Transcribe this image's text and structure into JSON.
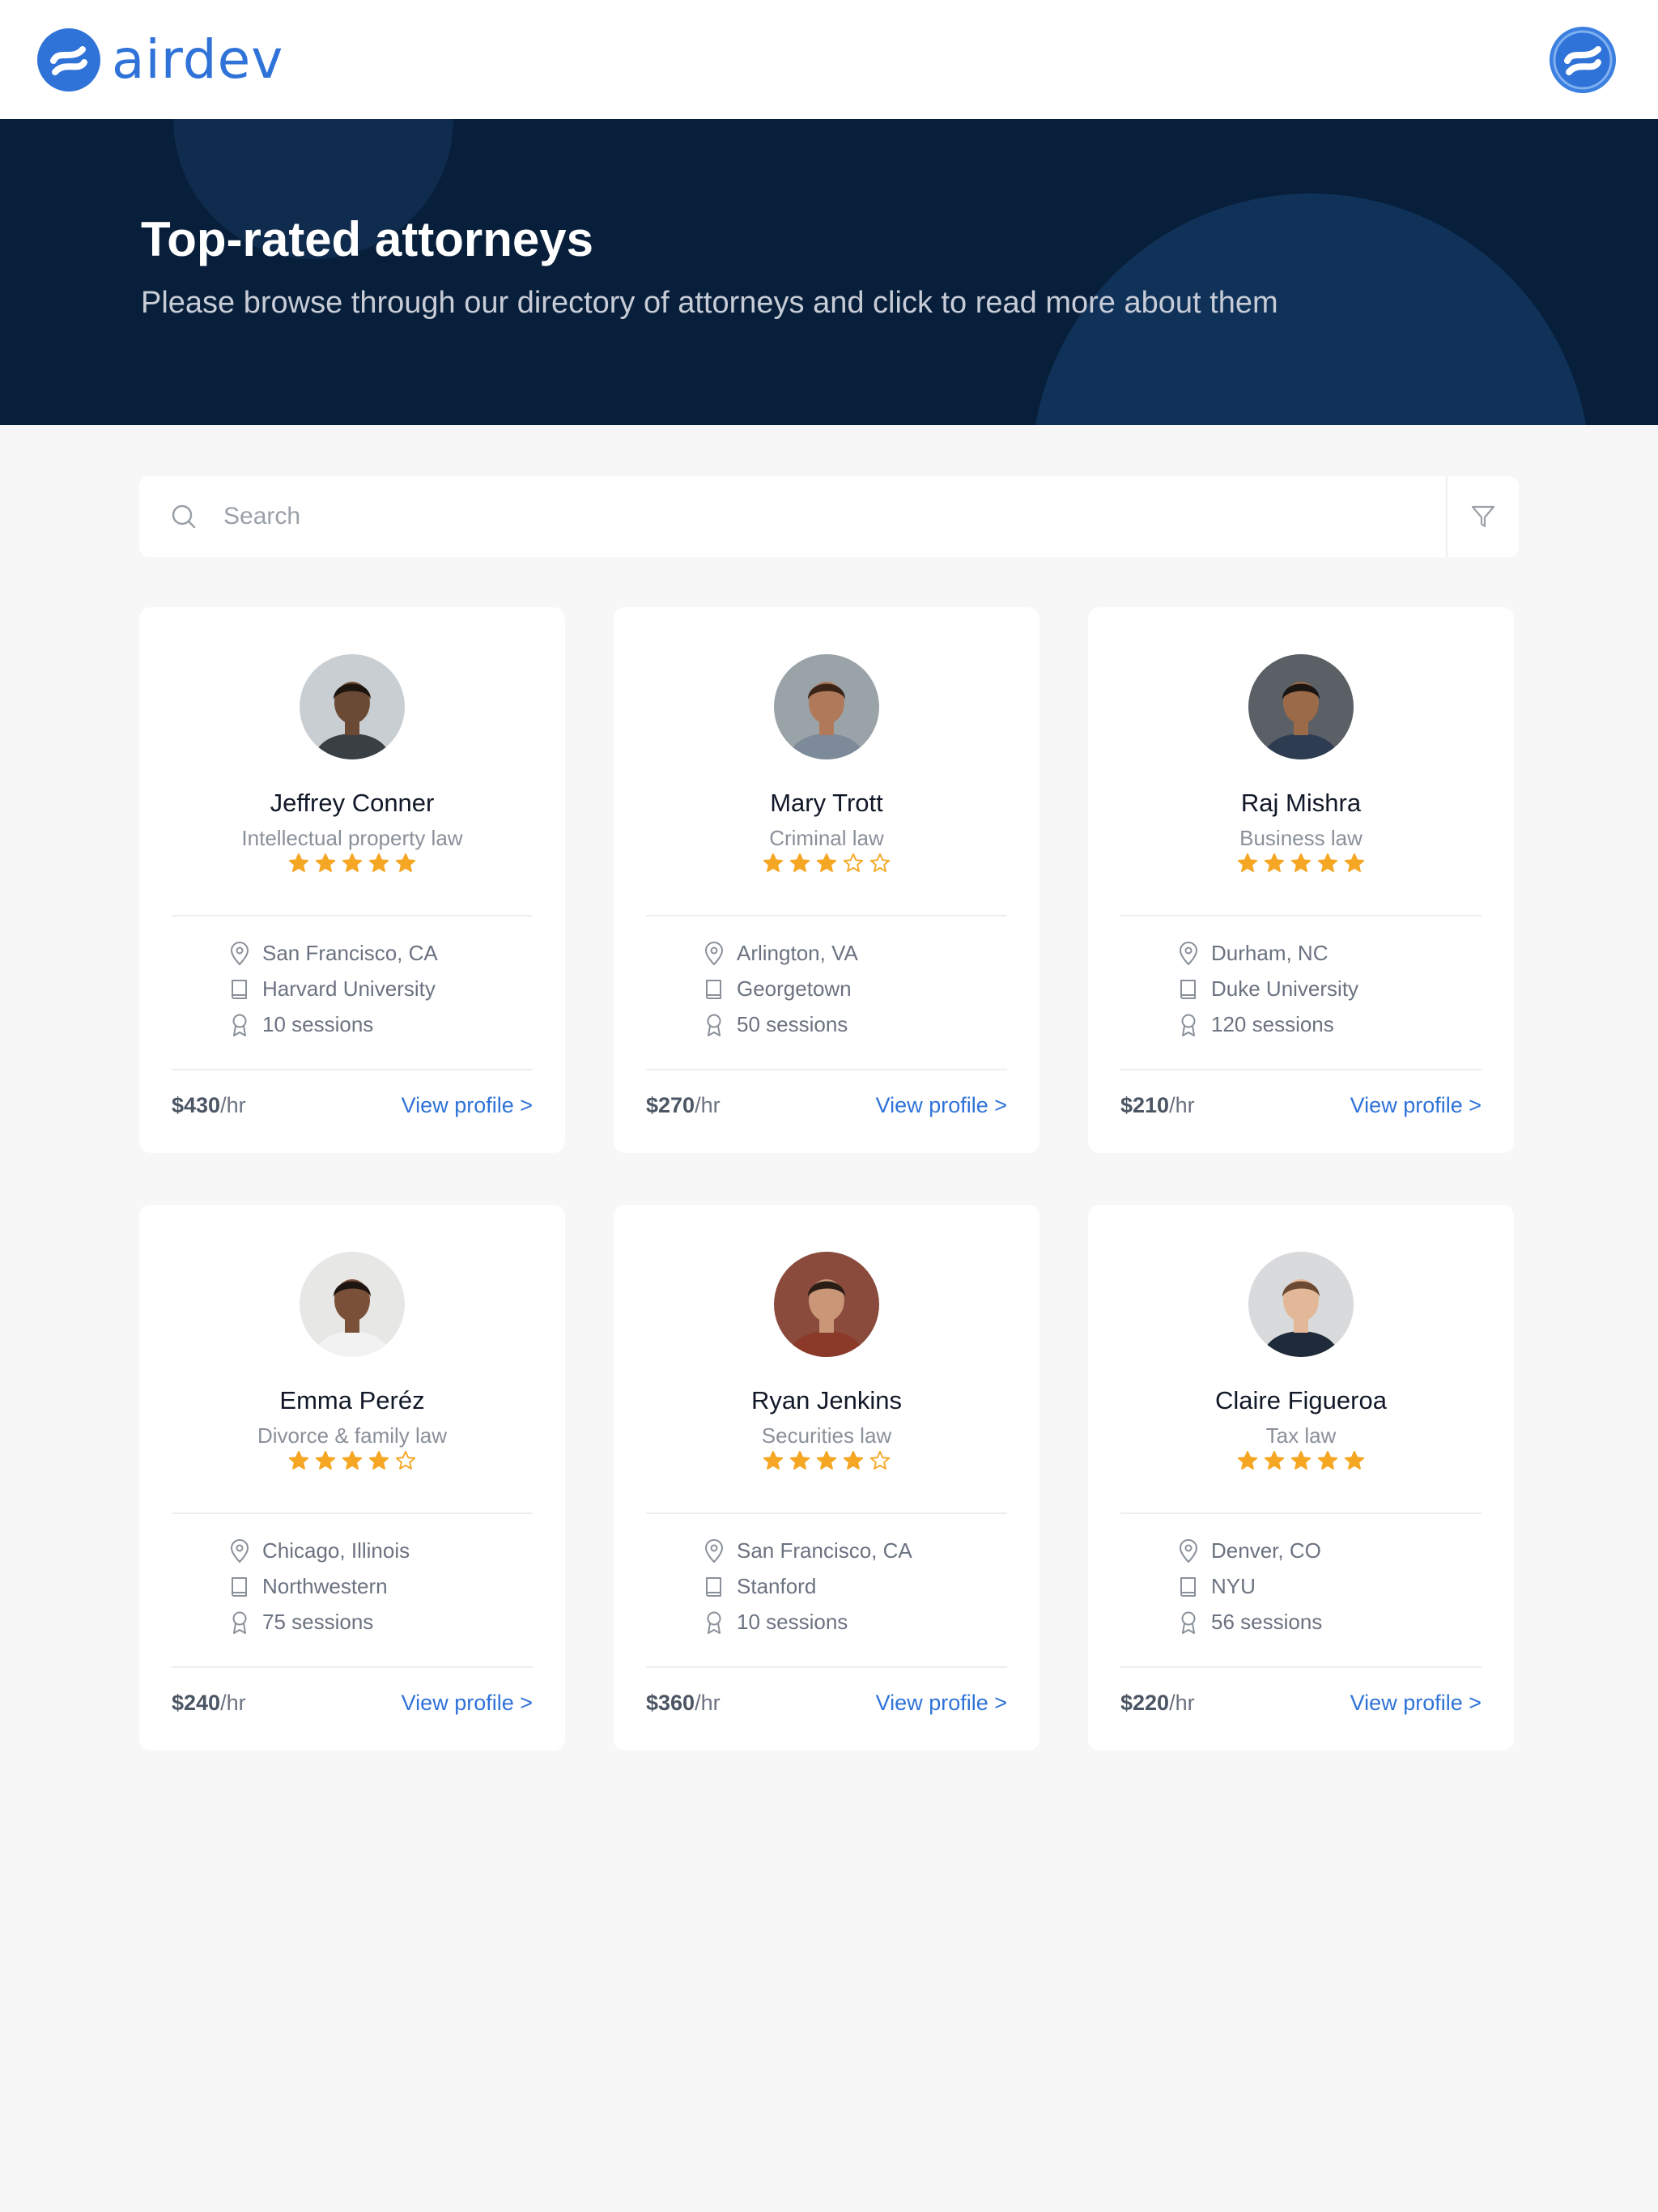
{
  "brand": {
    "name": "airdev",
    "color": "#2f73d8"
  },
  "header": {
    "logo_icon": "airdev-logo-icon",
    "user_avatar_icon": "airdev-avatar-icon"
  },
  "hero": {
    "title": "Top-rated attorneys",
    "subtitle": "Please browse through our directory of attorneys and click to read more about them",
    "background": "#081f3b"
  },
  "search": {
    "placeholder": "Search",
    "value": "",
    "icon": "search-icon",
    "filter_icon": "filter-icon"
  },
  "star_color": "#f5a623",
  "attorneys": [
    {
      "name": "Jeffrey Conner",
      "specialty": "Intellectual property law",
      "rating": 5,
      "location": "San Francisco, CA",
      "school": "Harvard University",
      "sessions": "10 sessions",
      "price": "$430",
      "price_unit": "/hr",
      "link": "View profile >"
    },
    {
      "name": "Mary Trott",
      "specialty": "Criminal law",
      "rating": 3,
      "location": "Arlington, VA",
      "school": "Georgetown",
      "sessions": "50 sessions",
      "price": "$270",
      "price_unit": "/hr",
      "link": "View profile >"
    },
    {
      "name": "Raj Mishra",
      "specialty": "Business law",
      "rating": 5,
      "location": "Durham, NC",
      "school": "Duke University",
      "sessions": "120 sessions",
      "price": "$210",
      "price_unit": "/hr",
      "link": "View profile >"
    },
    {
      "name": "Emma Peréz",
      "specialty": "Divorce & family law",
      "rating": 4,
      "location": "Chicago, Illinois",
      "school": "Northwestern",
      "sessions": "75 sessions",
      "price": "$240",
      "price_unit": "/hr",
      "link": "View profile >"
    },
    {
      "name": "Ryan Jenkins",
      "specialty": "Securities law",
      "rating": 4,
      "location": "San Francisco, CA",
      "school": "Stanford",
      "sessions": "10 sessions",
      "price": "$360",
      "price_unit": "/hr",
      "link": "View profile >"
    },
    {
      "name": "Claire Figueroa",
      "specialty": "Tax law",
      "rating": 5,
      "location": "Denver, CO",
      "school": "NYU",
      "sessions": "56 sessions",
      "price": "$220",
      "price_unit": "/hr",
      "link": "View profile >"
    }
  ]
}
